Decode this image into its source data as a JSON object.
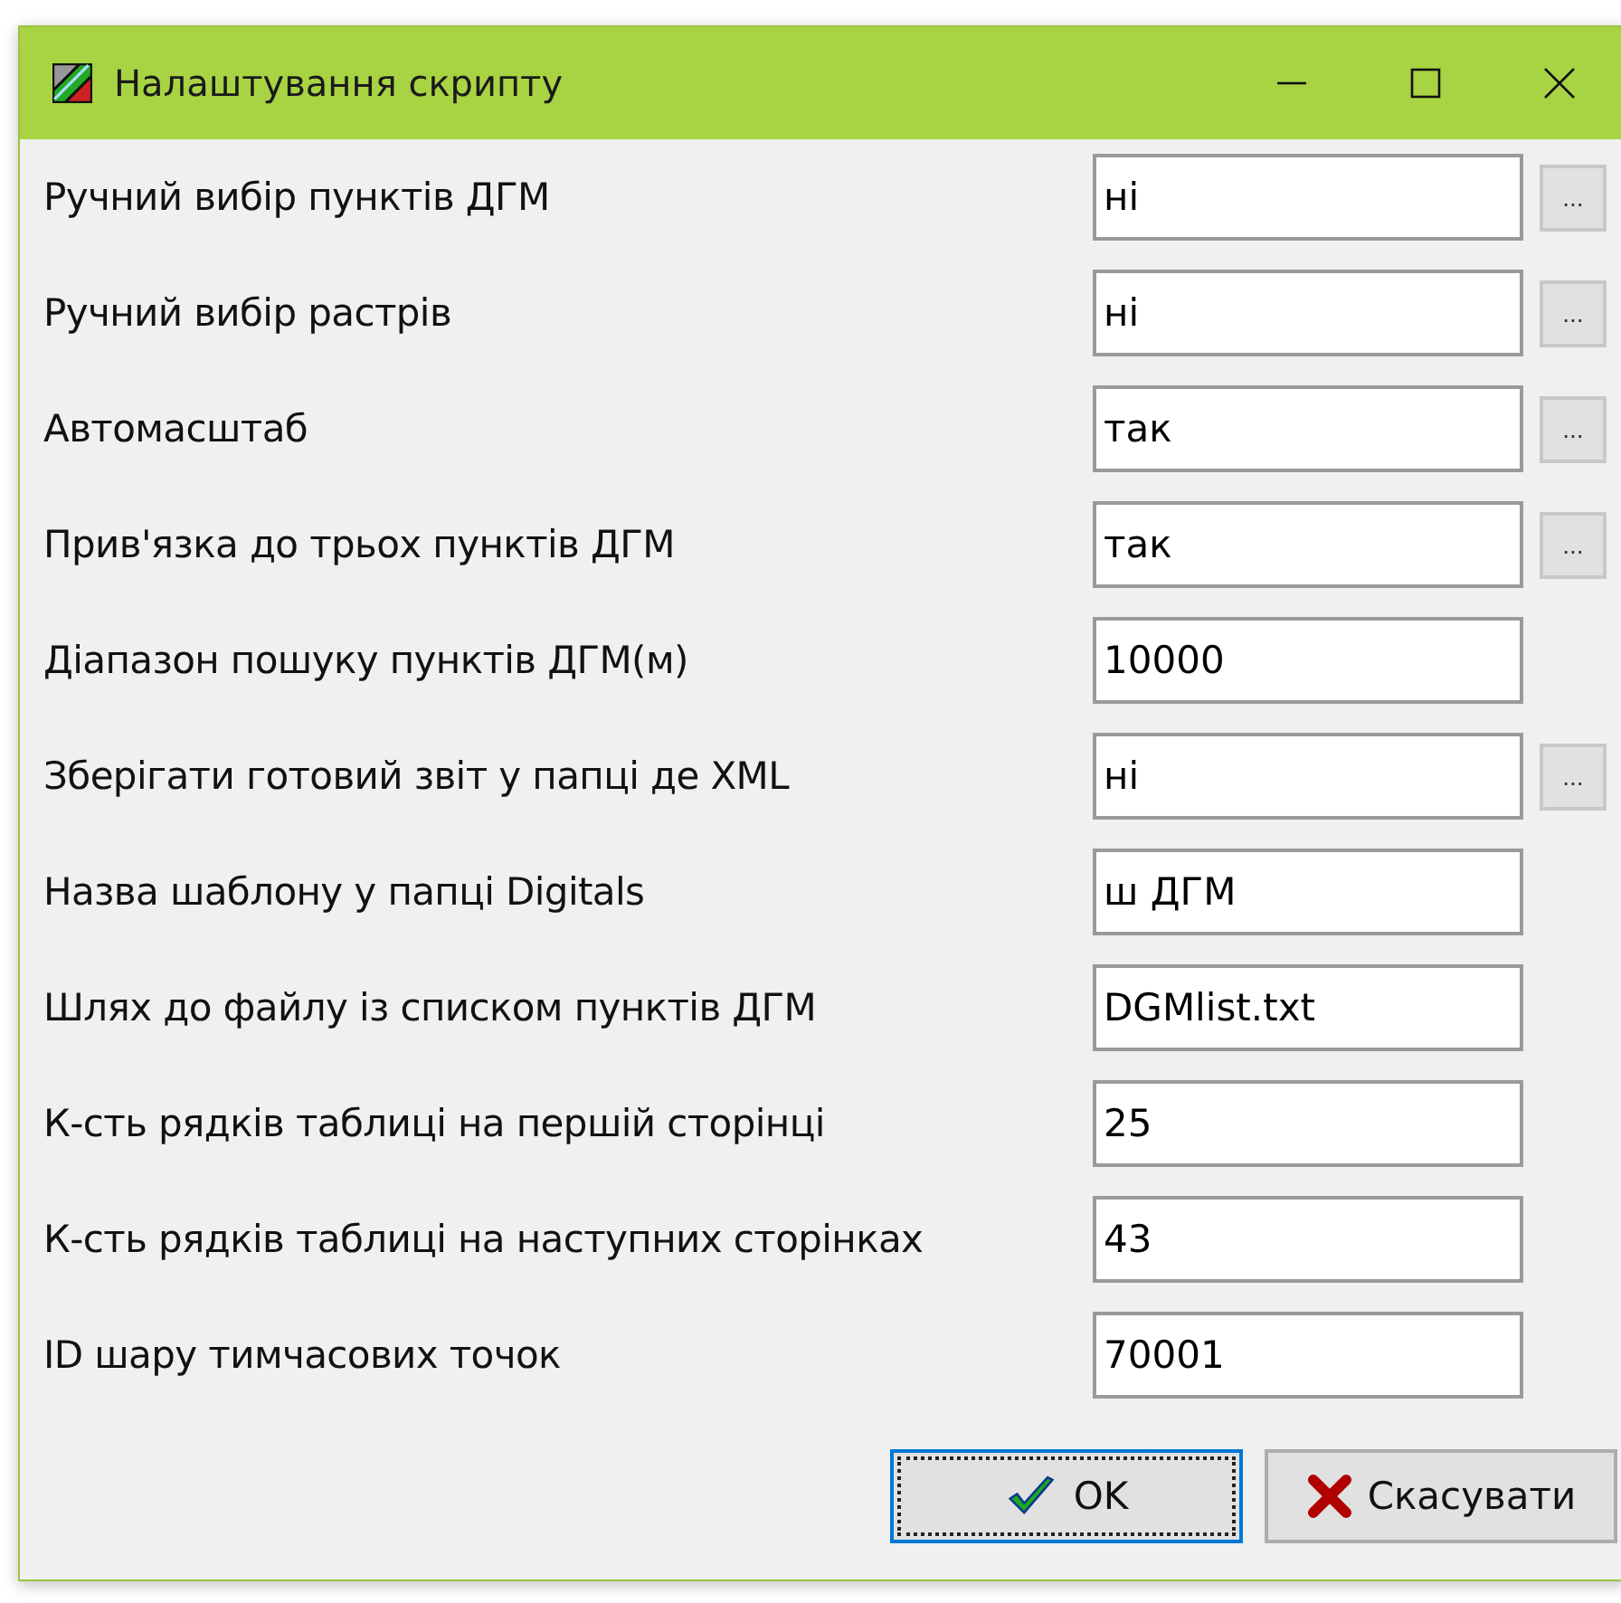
{
  "window": {
    "title": "Налаштування скрипту"
  },
  "settings": [
    {
      "label": "Ручний вибір пунктів ДГМ",
      "value": "ні",
      "kind": "choice",
      "button": "..."
    },
    {
      "label": "Ручний вибір растрів",
      "value": "ні",
      "kind": "choice",
      "button": "..."
    },
    {
      "label": "Автомасштаб",
      "value": "так",
      "kind": "choice",
      "button": "..."
    },
    {
      "label": "Прив'язка до трьох пунктів ДГМ",
      "value": "так",
      "kind": "choice",
      "button": "..."
    },
    {
      "label": "Діапазон пошуку пунктів ДГМ(м)",
      "value": "10000",
      "kind": "text"
    },
    {
      "label": "Зберігати готовий звіт у папці де XML",
      "value": "ні",
      "kind": "choice",
      "button": "..."
    },
    {
      "label": "Назва шаблону у папці Digitals",
      "value": "ш ДГМ",
      "kind": "text"
    },
    {
      "label": "Шлях до файлу із списком пунктів ДГМ",
      "value": "DGMlist.txt",
      "kind": "text"
    },
    {
      "label": "К-сть рядків таблиці на першій сторінці",
      "value": "25",
      "kind": "text"
    },
    {
      "label": "К-сть рядків таблиці на наступних сторінках",
      "value": "43",
      "kind": "text"
    },
    {
      "label": "ID шару тимчасових точок",
      "value": "70001",
      "kind": "text"
    }
  ],
  "buttons": [
    {
      "label": "OK",
      "kind": "ok",
      "focused": true
    },
    {
      "label": "Скасувати",
      "kind": "cancel",
      "focused": false
    }
  ]
}
